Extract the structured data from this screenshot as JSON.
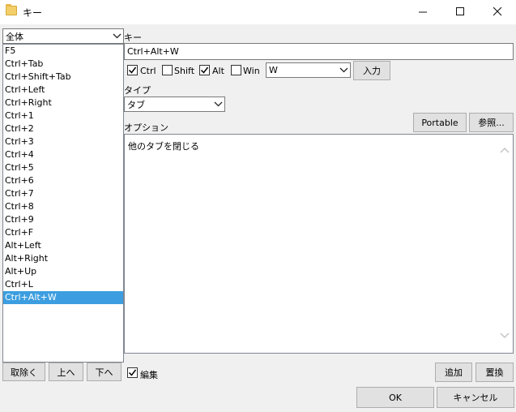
{
  "window": {
    "title": "キー",
    "icon": "folder-icon",
    "controls": {
      "minimize": "minimize-icon",
      "maximize": "maximize-icon",
      "close": "close-icon"
    }
  },
  "left": {
    "filter": {
      "selected": "全体"
    },
    "items": [
      {
        "label": "F5",
        "selected": false
      },
      {
        "label": "Ctrl+Tab",
        "selected": false
      },
      {
        "label": "Ctrl+Shift+Tab",
        "selected": false
      },
      {
        "label": "Ctrl+Left",
        "selected": false
      },
      {
        "label": "Ctrl+Right",
        "selected": false
      },
      {
        "label": "Ctrl+1",
        "selected": false
      },
      {
        "label": "Ctrl+2",
        "selected": false
      },
      {
        "label": "Ctrl+3",
        "selected": false
      },
      {
        "label": "Ctrl+4",
        "selected": false
      },
      {
        "label": "Ctrl+5",
        "selected": false
      },
      {
        "label": "Ctrl+6",
        "selected": false
      },
      {
        "label": "Ctrl+7",
        "selected": false
      },
      {
        "label": "Ctrl+8",
        "selected": false
      },
      {
        "label": "Ctrl+9",
        "selected": false
      },
      {
        "label": "Ctrl+F",
        "selected": false
      },
      {
        "label": "Alt+Left",
        "selected": false
      },
      {
        "label": "Alt+Right",
        "selected": false
      },
      {
        "label": "Alt+Up",
        "selected": false
      },
      {
        "label": "Ctrl+L",
        "selected": false
      },
      {
        "label": "Ctrl+Alt+W",
        "selected": true
      }
    ],
    "buttons": {
      "delete": "取除く",
      "up": "上へ",
      "down": "下へ"
    }
  },
  "key": {
    "label": "キー",
    "value": "Ctrl+Alt+W",
    "modifiers": {
      "ctrl": {
        "label": "Ctrl",
        "checked": true
      },
      "shift": {
        "label": "Shift",
        "checked": false
      },
      "alt": {
        "label": "Alt",
        "checked": true
      },
      "win": {
        "label": "Win",
        "checked": false
      }
    },
    "key_select": "W",
    "input_button": "入力"
  },
  "type": {
    "label": "タイプ",
    "selected": "タブ"
  },
  "options": {
    "label": "オプション",
    "portable_button": "Portable",
    "browse_button": "参照...",
    "text": "他のタブを閉じる"
  },
  "bottom": {
    "edit_checkbox": {
      "label": "編集",
      "checked": true
    },
    "add_button": "追加",
    "replace_button": "置換",
    "ok_button": "OK",
    "cancel_button": "キャンセル"
  },
  "colors": {
    "selection": "#3c9ee0",
    "button_face": "#e1e1e1",
    "dialog_bg": "#f0f0f0"
  }
}
